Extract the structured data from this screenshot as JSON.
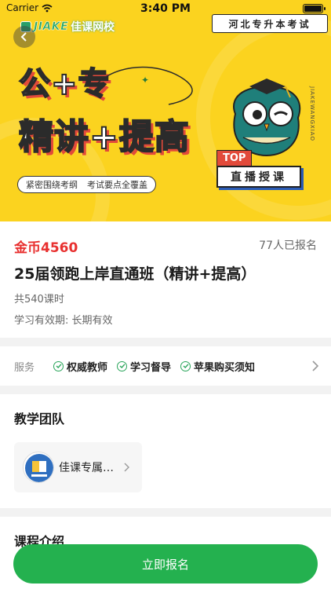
{
  "status_bar": {
    "carrier": "Carrier",
    "time": "3:40 PM",
    "battery_level": 1.0
  },
  "banner": {
    "logo_en": "JIAKE",
    "logo_cn": "佳课网校",
    "exam_tag": "河北专升本考试",
    "headline_line1": "公+专",
    "headline_line2": "精讲+提高",
    "slogan_1": "紧密围绕考纲",
    "slogan_2": "考试要点全覆盖",
    "side_text": "JIAKEWANGXIAO",
    "badge_top": "TOP",
    "badge_live": "直播授课",
    "colors": {
      "background": "#fbd31f",
      "accent_red": "#e24a3a",
      "accent_green": "#2ba869"
    }
  },
  "course": {
    "price": "金币4560",
    "enrolled": "77人已报名",
    "title": "25届领跑上岸直通班（精讲+提高）",
    "hours": "共540课时",
    "validity": "学习有效期: 长期有效"
  },
  "services": {
    "label": "服务",
    "items": [
      {
        "label": "权威教师",
        "icon": "check-circle-icon"
      },
      {
        "label": "学习督导",
        "icon": "check-circle-icon"
      },
      {
        "label": "苹果购买须知",
        "icon": "check-circle-icon"
      }
    ]
  },
  "team": {
    "title": "教学团队",
    "teachers": [
      {
        "name": "佳课专属讲师"
      }
    ]
  },
  "intro": {
    "title": "课程介绍"
  },
  "cta": {
    "label": "立即报名",
    "color": "#24b14f"
  }
}
